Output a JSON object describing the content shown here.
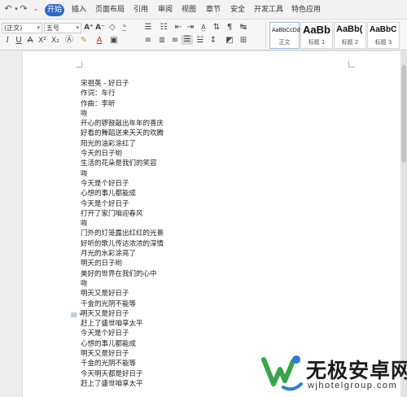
{
  "menu": {
    "tabs": [
      {
        "label": "开始",
        "active": true
      },
      {
        "label": "插入",
        "active": false
      },
      {
        "label": "页面布局",
        "active": false
      },
      {
        "label": "引用",
        "active": false
      },
      {
        "label": "审阅",
        "active": false
      },
      {
        "label": "视图",
        "active": false
      },
      {
        "label": "章节",
        "active": false
      },
      {
        "label": "安全",
        "active": false
      },
      {
        "label": "开发工具",
        "active": false
      },
      {
        "label": "特色应用",
        "active": false
      }
    ],
    "active_color": "#2b6ad3"
  },
  "ribbon": {
    "font_name": "(正文)",
    "font_size": "五号",
    "styles": [
      {
        "sample": "AaBbCcDd",
        "name": "正文"
      },
      {
        "sample": "AaBb",
        "name": "标题 1"
      },
      {
        "sample": "AaBb(",
        "name": "标题 2"
      },
      {
        "sample": "AaBbC",
        "name": "标题 3"
      }
    ]
  },
  "document": {
    "lines": [
      "宋祖英 - 好日子",
      "作词：车行",
      "作曲：李昕",
      "咴",
      "开心的锣鼓敲出年年的喜庆",
      "好看的舞蹈送来天天的欢腾",
      "阳光的油彩涂红了",
      "今天的日子哟",
      "生活的花朵是我们的笑容",
      "咴",
      "今天是个好日子",
      "心想的事儿都能成",
      "今天是个好日子",
      "打开了家门咱迎春风",
      "咴",
      "门外的灯笼露出红红的光景",
      "好听的歌儿传达浓浓的深情",
      "月光的水彩涂亮了",
      "明天的日子哟",
      "美好的世界在我们的心中",
      "咴",
      "明天又是好日子",
      "千金的光阴不能等",
      "明天又是好日子",
      "赶上了盛世咱享太平",
      "今天是个好日子",
      "心想的事儿都能成",
      "明天又是好日子",
      "千金的光阴不能等",
      "今天明天都是好日子",
      "赶上了盛世咱享太平"
    ]
  },
  "watermark": {
    "title": "无极安卓网",
    "url": "wjhotelgroup.com",
    "logo_colors": [
      "#3aa24a",
      "#2b7bd6"
    ]
  }
}
